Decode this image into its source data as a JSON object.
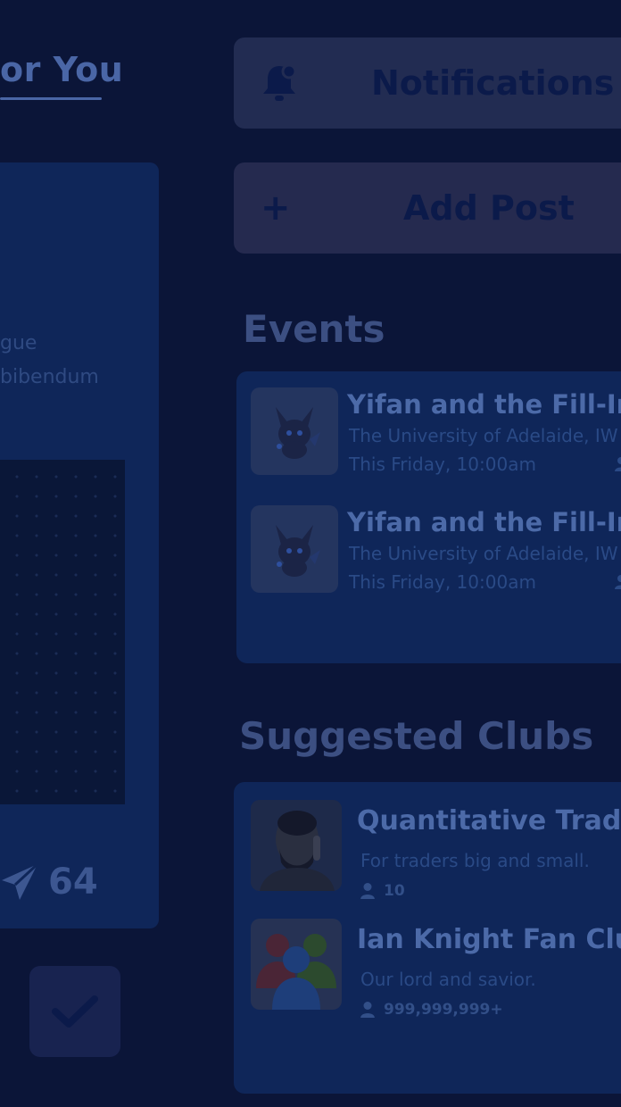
{
  "feed": {
    "tab_title": "or You",
    "post": {
      "text_lines": [
        "gue",
        "bibendum"
      ],
      "share_count": "64"
    }
  },
  "actions": {
    "notifications_label": "Notifications",
    "add_post_label": "Add Post",
    "add_post_icon": "+"
  },
  "events": {
    "title": "Events",
    "items": [
      {
        "title": "Yifan and the Fill-In",
        "location": "The University of Adelaide, IW",
        "time": "This Friday, 10:00am"
      },
      {
        "title": "Yifan and the Fill-In",
        "location": "The University of Adelaide, IW",
        "time": "This Friday, 10:00am"
      }
    ]
  },
  "clubs": {
    "title": "Suggested Clubs",
    "items": [
      {
        "name": "Quantitative Trading",
        "tagline": "For traders big and small.",
        "members": "10"
      },
      {
        "name": "Ian Knight Fan Club",
        "tagline": "Our lord and savior.",
        "members": "999,999,999+"
      }
    ]
  },
  "colors": {
    "background": "#0b1538",
    "card": "#0f2659",
    "button": "#222c52",
    "accent_text": "#4c6aa8"
  },
  "icons": {
    "notifications": "bell-icon",
    "add_post": "plus-icon",
    "share": "paper-plane-icon",
    "confirm": "checkmark-icon",
    "members": "person-icon"
  }
}
